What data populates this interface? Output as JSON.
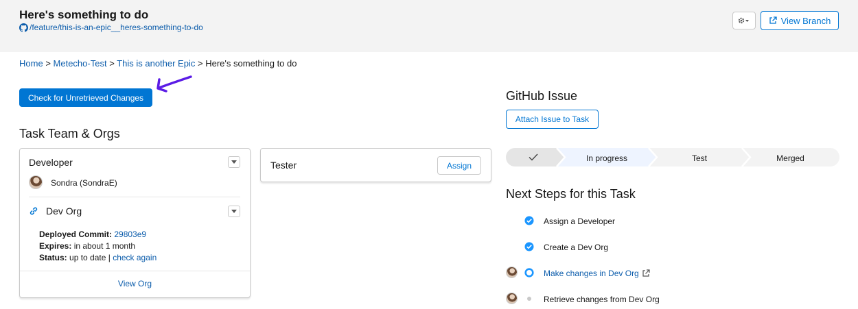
{
  "header": {
    "title": "Here's something to do",
    "branch": "/feature/this-is-an-epic__heres-something-to-do",
    "view_branch_label": "View Branch"
  },
  "breadcrumb": {
    "items": [
      "Home",
      "Metecho-Test",
      "This is another Epic"
    ],
    "current": "Here's something to do",
    "separator": ">"
  },
  "actions": {
    "check_changes_label": "Check for Unretrieved Changes"
  },
  "team": {
    "title": "Task Team & Orgs",
    "developer": {
      "role": "Developer",
      "user": "Sondra (SondraE)",
      "org_name": "Dev Org",
      "commit_label": "Deployed Commit:",
      "commit_value": "29803e9",
      "expires_label": "Expires:",
      "expires_value": "in about 1 month",
      "status_label": "Status:",
      "status_value": "up to date |",
      "check_again": "check again",
      "view_org": "View Org"
    },
    "tester": {
      "role": "Tester",
      "assign_label": "Assign"
    }
  },
  "github": {
    "title": "GitHub Issue",
    "attach_label": "Attach Issue to Task"
  },
  "progress_path": {
    "steps": [
      "",
      "In progress",
      "Test",
      "Merged"
    ],
    "current_index": 1,
    "colors": {
      "complete": "#e5e5e5",
      "current": "#eef4ff",
      "incomplete": "#f3f3f3"
    }
  },
  "next_steps": {
    "title": "Next Steps for this Task",
    "items": [
      {
        "label": "Assign a Developer",
        "status": "complete",
        "has_avatar": false
      },
      {
        "label": "Create a Dev Org",
        "status": "complete",
        "has_avatar": false
      },
      {
        "label": "Make changes in Dev Org",
        "status": "active",
        "has_avatar": true,
        "external": true
      },
      {
        "label": "Retrieve changes from Dev Org",
        "status": "pending",
        "has_avatar": true
      }
    ]
  },
  "colors": {
    "brand": "#0176d3",
    "link": "#0b5cab",
    "annotation_arrow": "#5b1ce6",
    "check_complete": "#1b96ff"
  }
}
